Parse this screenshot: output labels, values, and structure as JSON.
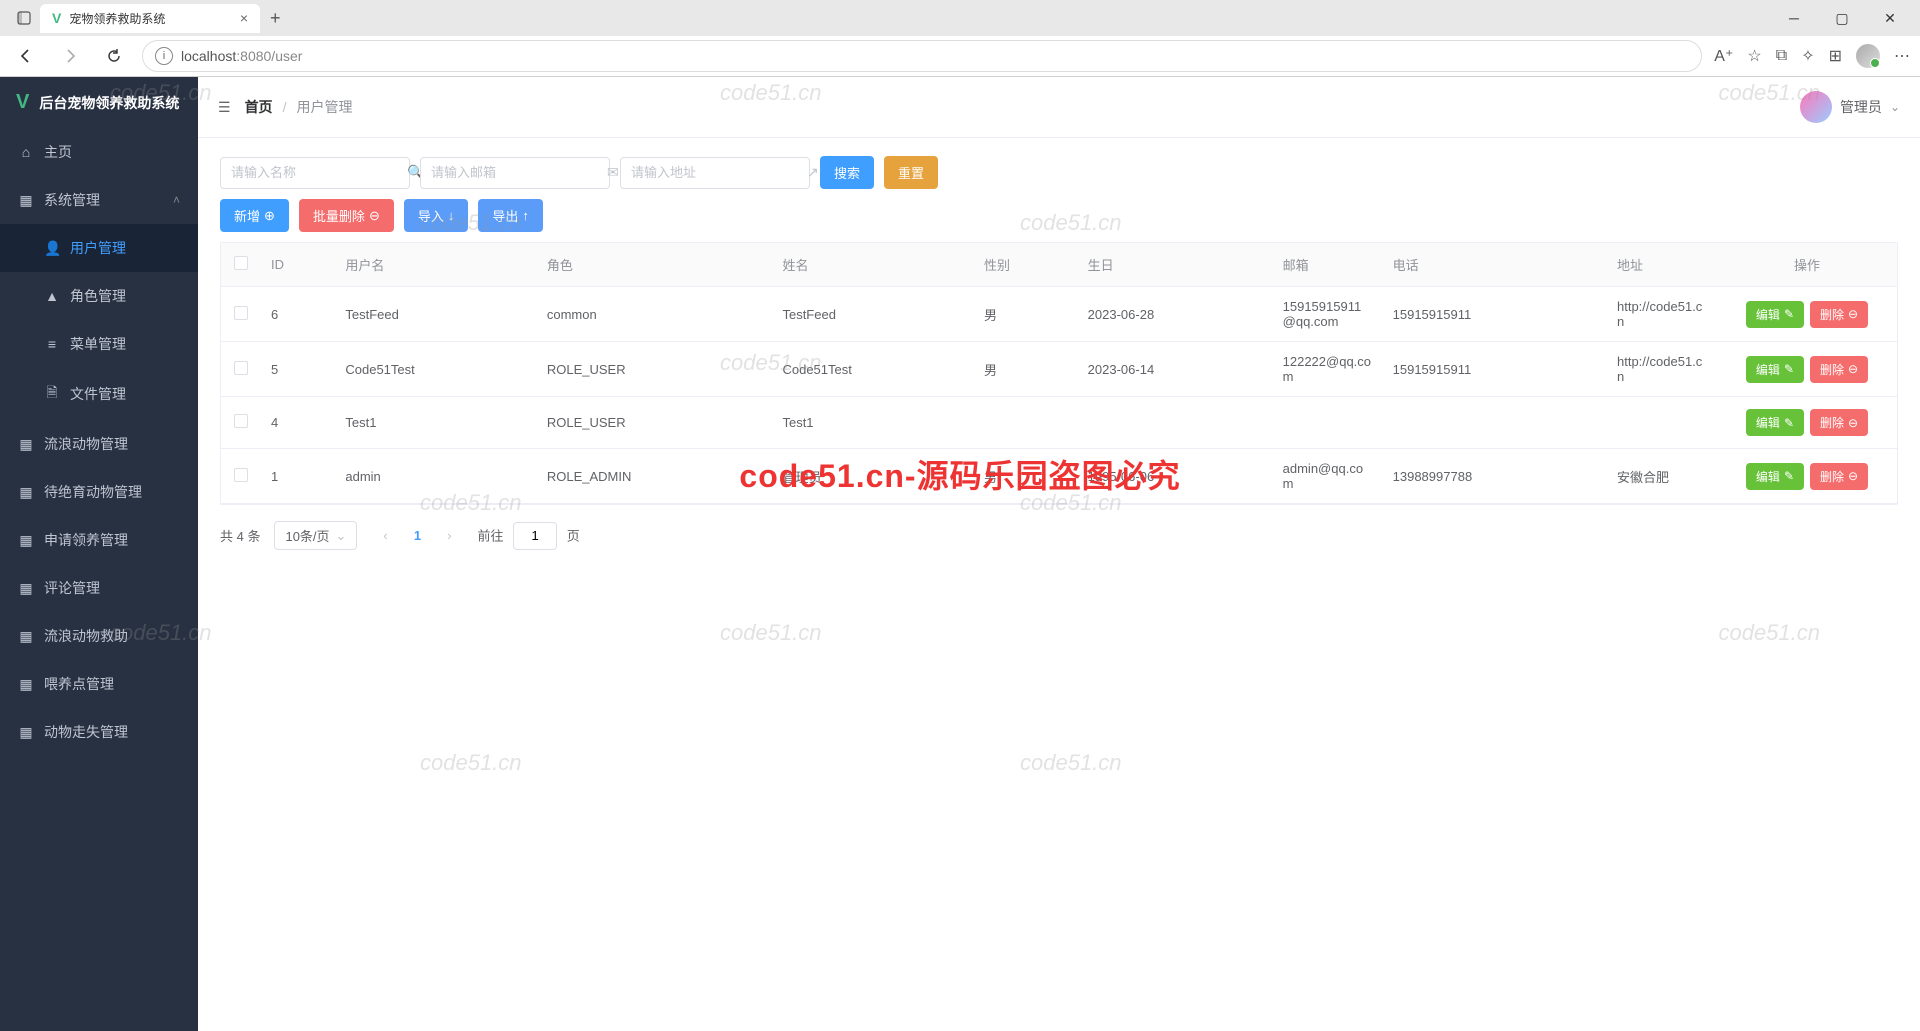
{
  "browser": {
    "tab_title": "宠物领养救助系统",
    "url_host": "localhost",
    "url_path": ":8080/user"
  },
  "app_title": "后台宠物领养救助系统",
  "sidebar": {
    "home": "主页",
    "system_mgmt": "系统管理",
    "user_mgmt": "用户管理",
    "role_mgmt": "角色管理",
    "menu_mgmt": "菜单管理",
    "file_mgmt": "文件管理",
    "stray_mgmt": "流浪动物管理",
    "sterilize_mgmt": "待绝育动物管理",
    "adopt_mgmt": "申请领养管理",
    "comment_mgmt": "评论管理",
    "rescue_mgmt": "流浪动物救助",
    "feed_point_mgmt": "喂养点管理",
    "lost_mgmt": "动物走失管理"
  },
  "header": {
    "home": "首页",
    "current": "用户管理",
    "user_name": "管理员"
  },
  "search": {
    "name_ph": "请输入名称",
    "email_ph": "请输入邮箱",
    "addr_ph": "请输入地址",
    "search_btn": "搜索",
    "reset_btn": "重置"
  },
  "actions": {
    "add": "新增",
    "batch_del": "批量删除",
    "import": "导入",
    "export": "导出"
  },
  "columns": {
    "id": "ID",
    "username": "用户名",
    "role": "角色",
    "name": "姓名",
    "gender": "性别",
    "birthday": "生日",
    "email": "邮箱",
    "phone": "电话",
    "address": "地址",
    "ops": "操作"
  },
  "row_labels": {
    "edit": "编辑",
    "delete": "删除"
  },
  "rows": [
    {
      "id": "6",
      "username": "TestFeed",
      "role": "common",
      "name": "TestFeed",
      "gender": "男",
      "birthday": "2023-06-28",
      "email": "15915915911@qq.com",
      "phone": "15915915911",
      "address": "http://code51.cn"
    },
    {
      "id": "5",
      "username": "Code51Test",
      "role": "ROLE_USER",
      "name": "Code51Test",
      "gender": "男",
      "birthday": "2023-06-14",
      "email": "122222@qq.com",
      "phone": "15915915911",
      "address": "http://code51.cn"
    },
    {
      "id": "4",
      "username": "Test1",
      "role": "ROLE_USER",
      "name": "Test1",
      "gender": "",
      "birthday": "",
      "email": "",
      "phone": "",
      "address": ""
    },
    {
      "id": "1",
      "username": "admin",
      "role": "ROLE_ADMIN",
      "name": "管理员",
      "gender": "男",
      "birthday": "1995-06-06",
      "email": "admin@qq.com",
      "phone": "13988997788",
      "address": "安徽合肥"
    }
  ],
  "pagination": {
    "total_label": "共 4 条",
    "page_size": "10条/页",
    "current": "1",
    "jump_prefix": "前往",
    "jump_suffix": "页",
    "jump_value": "1"
  },
  "watermark": "code51.cn",
  "center_watermark": "code51.cn-源码乐园盗图必究"
}
